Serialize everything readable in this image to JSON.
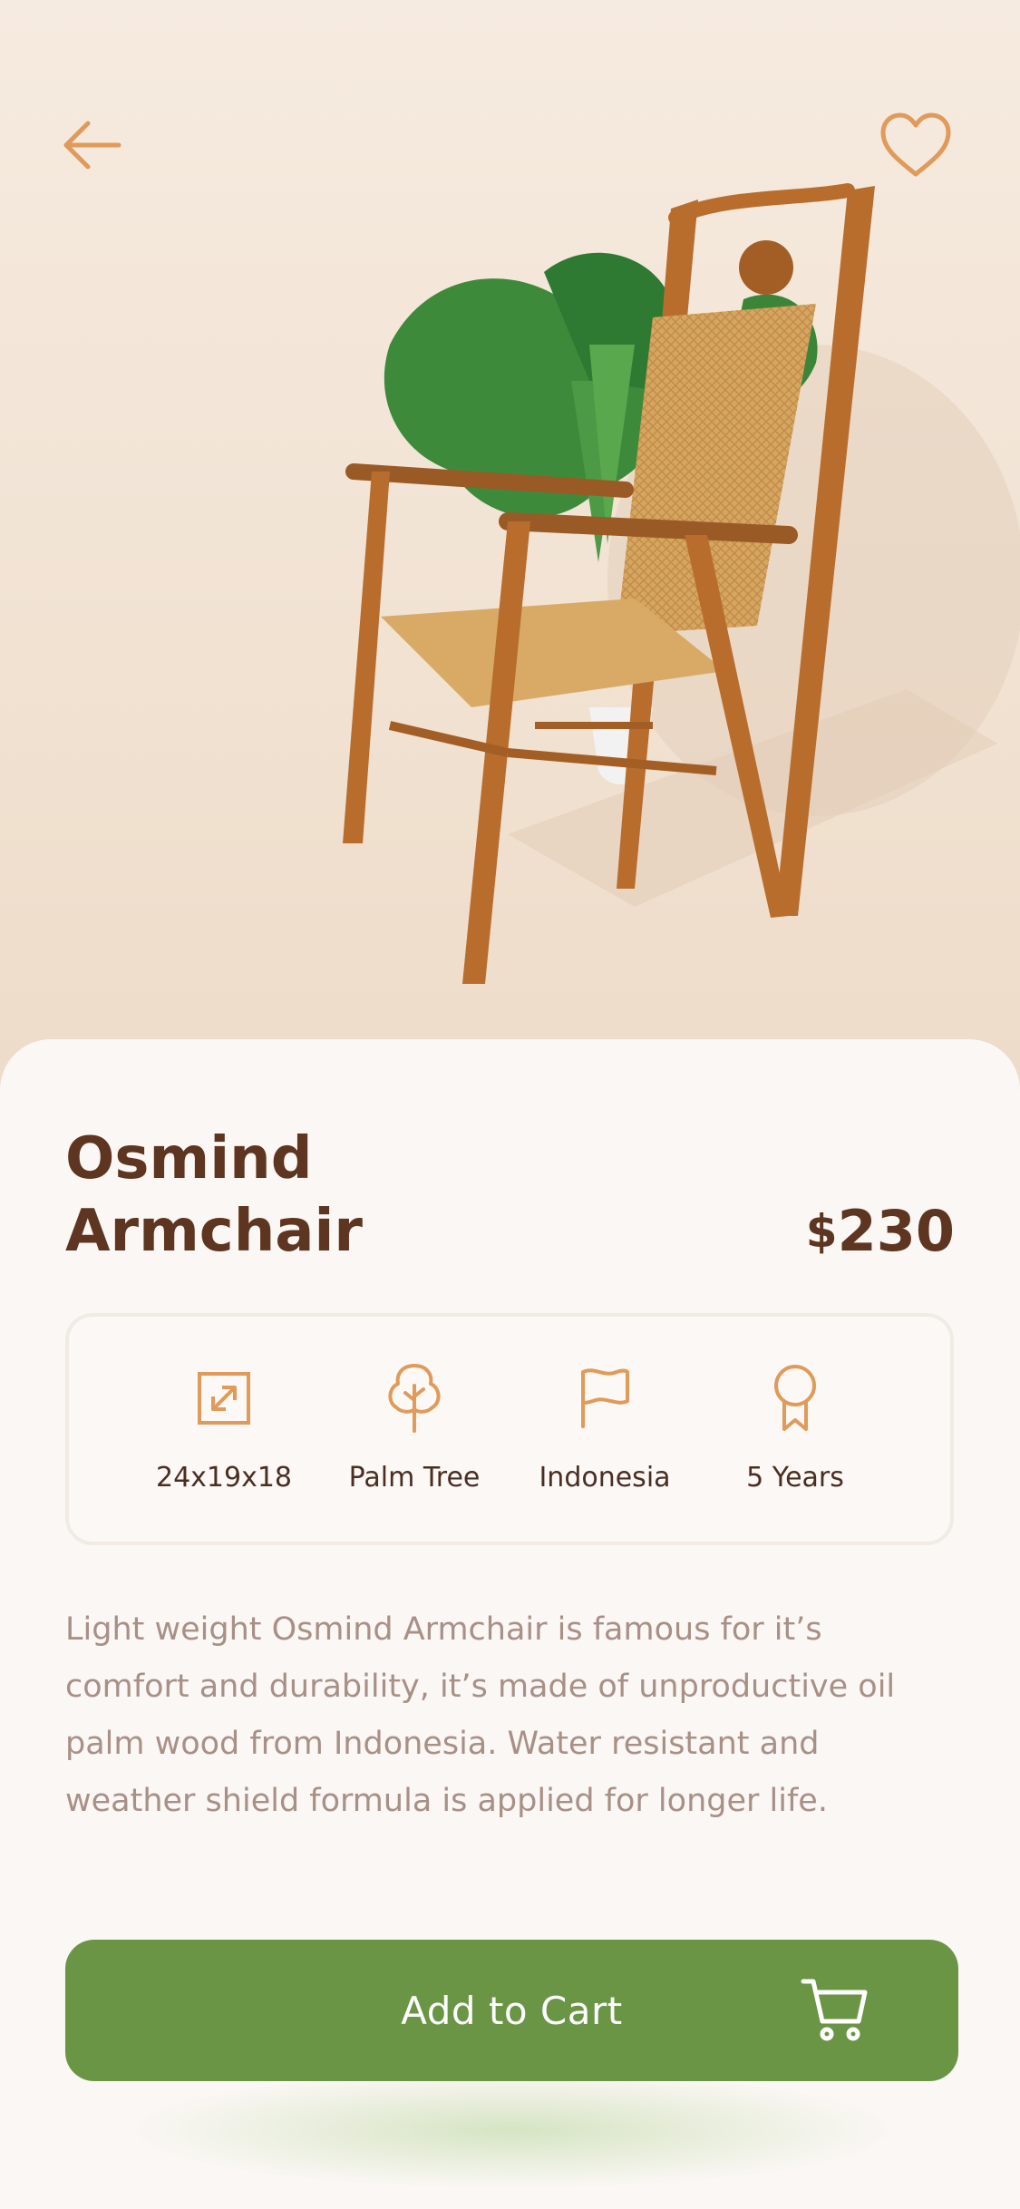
{
  "nav": {
    "back_icon": "arrow-left-icon",
    "favorite_icon": "heart-icon"
  },
  "product": {
    "title_line1": "Osmind",
    "title_line2": "Armchair",
    "currency": "$",
    "price": "230",
    "specs": [
      {
        "icon": "expand-dimensions-icon",
        "label": "24x19x18"
      },
      {
        "icon": "tree-icon",
        "label": "Palm Tree"
      },
      {
        "icon": "flag-icon",
        "label": "Indonesia"
      },
      {
        "icon": "award-ribbon-icon",
        "label": "5 Years"
      }
    ],
    "description": "Light weight Osmind Armchair is famous for it’s comfort and durability, it’s made of unproductive oil palm wood from Indonesia. Water resistant and weather shield formula is applied for longer life."
  },
  "cart": {
    "label": "Add to Cart",
    "icon": "shopping-cart-icon"
  },
  "colors": {
    "accent": "#e09a5a",
    "title": "#5e3520",
    "button": "#6a9545",
    "description": "#a89087"
  }
}
